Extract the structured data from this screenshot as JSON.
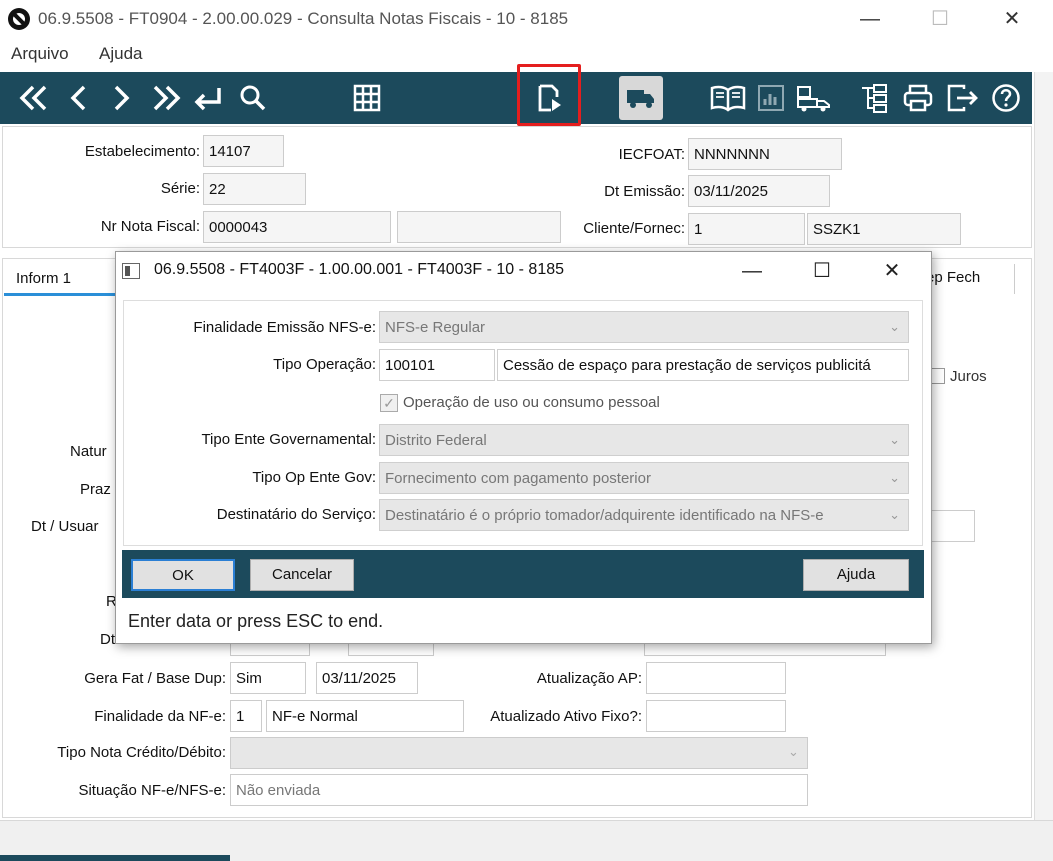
{
  "window": {
    "title": "06.9.5508 - FT0904 - 2.00.00.029 - Consulta Notas Fiscais - 10 - 8185",
    "minimize": "—",
    "maximize": "☐",
    "close": "✕"
  },
  "menu": {
    "file": "Arquivo",
    "help": "Ajuda"
  },
  "toolbar": {
    "icons": [
      "first-icon",
      "prev-icon",
      "next-icon",
      "last-icon",
      "return-icon",
      "search-icon",
      "grid-icon",
      "document-edit-icon",
      "truck-icon",
      "book-icon",
      "report-icon",
      "delivery-icon",
      "tree-icon",
      "print-icon",
      "exit-icon",
      "help-icon"
    ]
  },
  "header": {
    "estabelecimento_label": "Estabelecimento:",
    "estabelecimento_value": "14107",
    "serie_label": "Série:",
    "serie_value": "22",
    "nr_nota_label": "Nr Nota Fiscal:",
    "nr_nota_value": "0000043",
    "nr_nota_extra": "",
    "iecfoat_label": "IECFOAT:",
    "iecfoat_value": "NNNNNNN",
    "dt_emissao_label": "Dt Emissão:",
    "dt_emissao_value": "03/11/2025",
    "cliente_label": "Cliente/Fornec:",
    "cliente_code": "1",
    "cliente_name": "SSZK1"
  },
  "tabs": {
    "active": "Inform 1",
    "partial_right": "ep Fech"
  },
  "background_form": {
    "partial_labels": [
      "Natur",
      "Praz",
      "Dt / Usuar",
      "R",
      "Dt"
    ],
    "juros_label": "Juros",
    "gera_fat_label": "Gera Fat / Base Dup:",
    "gera_fat_value": "Sim",
    "base_dup_value": "03/11/2025",
    "atualizacao_ap_label": "Atualização AP:",
    "atualizacao_ap_value": "",
    "finalidade_nfe_label": "Finalidade da NF-e:",
    "finalidade_nfe_code": "1",
    "finalidade_nfe_value": "NF-e Normal",
    "atualizado_ativo_label": "Atualizado Ativo Fixo?:",
    "atualizado_ativo_value": "",
    "tipo_nota_label": "Tipo Nota Crédito/Débito:",
    "tipo_nota_value": "",
    "situacao_label": "Situação NF-e/NFS-e:",
    "situacao_value": "Não enviada"
  },
  "dialog": {
    "title": "06.9.5508 - FT4003F - 1.00.00.001 - FT4003F - 10 - 8185",
    "minimize": "—",
    "maximize": "☐",
    "close": "✕",
    "finalidade_label": "Finalidade Emissão NFS-e:",
    "finalidade_value": "NFS-e Regular",
    "tipo_operacao_label": "Tipo Operação:",
    "tipo_operacao_code": "100101",
    "tipo_operacao_desc": "Cessão de espaço para prestação de serviços publicitá",
    "uso_consumo_label": "Operação de uso ou consumo pessoal",
    "uso_consumo_checked": true,
    "tipo_ente_label": "Tipo Ente Governamental:",
    "tipo_ente_value": "Distrito Federal",
    "tipo_op_ente_label": "Tipo Op Ente Gov:",
    "tipo_op_ente_value": "Fornecimento com pagamento posterior",
    "destinatario_label": "Destinatário do Serviço:",
    "destinatario_value": "Destinatário é o próprio tomador/adquirente identificado na NFS-e",
    "ok_label": "OK",
    "cancel_label": "Cancelar",
    "help_label": "Ajuda",
    "status_text": "Enter data or press ESC to end."
  },
  "colors": {
    "toolbar_bg": "#1c4a5c",
    "highlight": "#e41e1e",
    "tab_underline": "#2a8fd8",
    "ok_border": "#2b7fd4"
  }
}
